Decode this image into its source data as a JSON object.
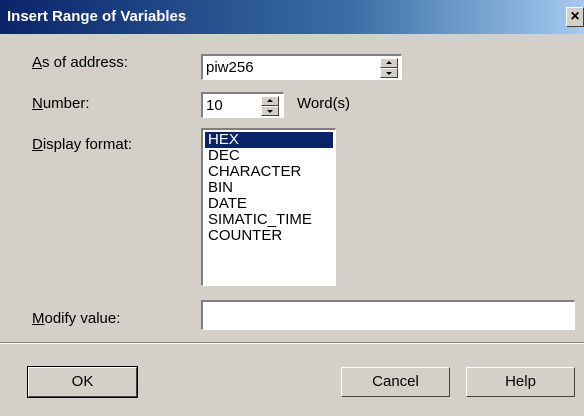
{
  "window": {
    "title": "Insert Range of Variables",
    "close_glyph": "×"
  },
  "form": {
    "address": {
      "label_mnemonic": "A",
      "label_rest": "s of address:",
      "value": "piw256"
    },
    "number": {
      "label_mnemonic": "N",
      "label_rest": "umber:",
      "value": "10",
      "unit": "Word(s)"
    },
    "display_format": {
      "label_mnemonic": "D",
      "label_rest": "isplay format:",
      "options": [
        "HEX",
        "DEC",
        "CHARACTER",
        "BIN",
        "DATE",
        "SIMATIC_TIME",
        "COUNTER"
      ],
      "selected": "HEX"
    },
    "modify_value": {
      "label_mnemonic": "M",
      "label_rest": "odify value:",
      "value": ""
    }
  },
  "buttons": {
    "ok": "OK",
    "cancel": "Cancel",
    "help": "Help"
  },
  "colors": {
    "dialog_bg": "#d4d0c8",
    "title_bar": "#0a246a",
    "selection": "#0a246a"
  }
}
